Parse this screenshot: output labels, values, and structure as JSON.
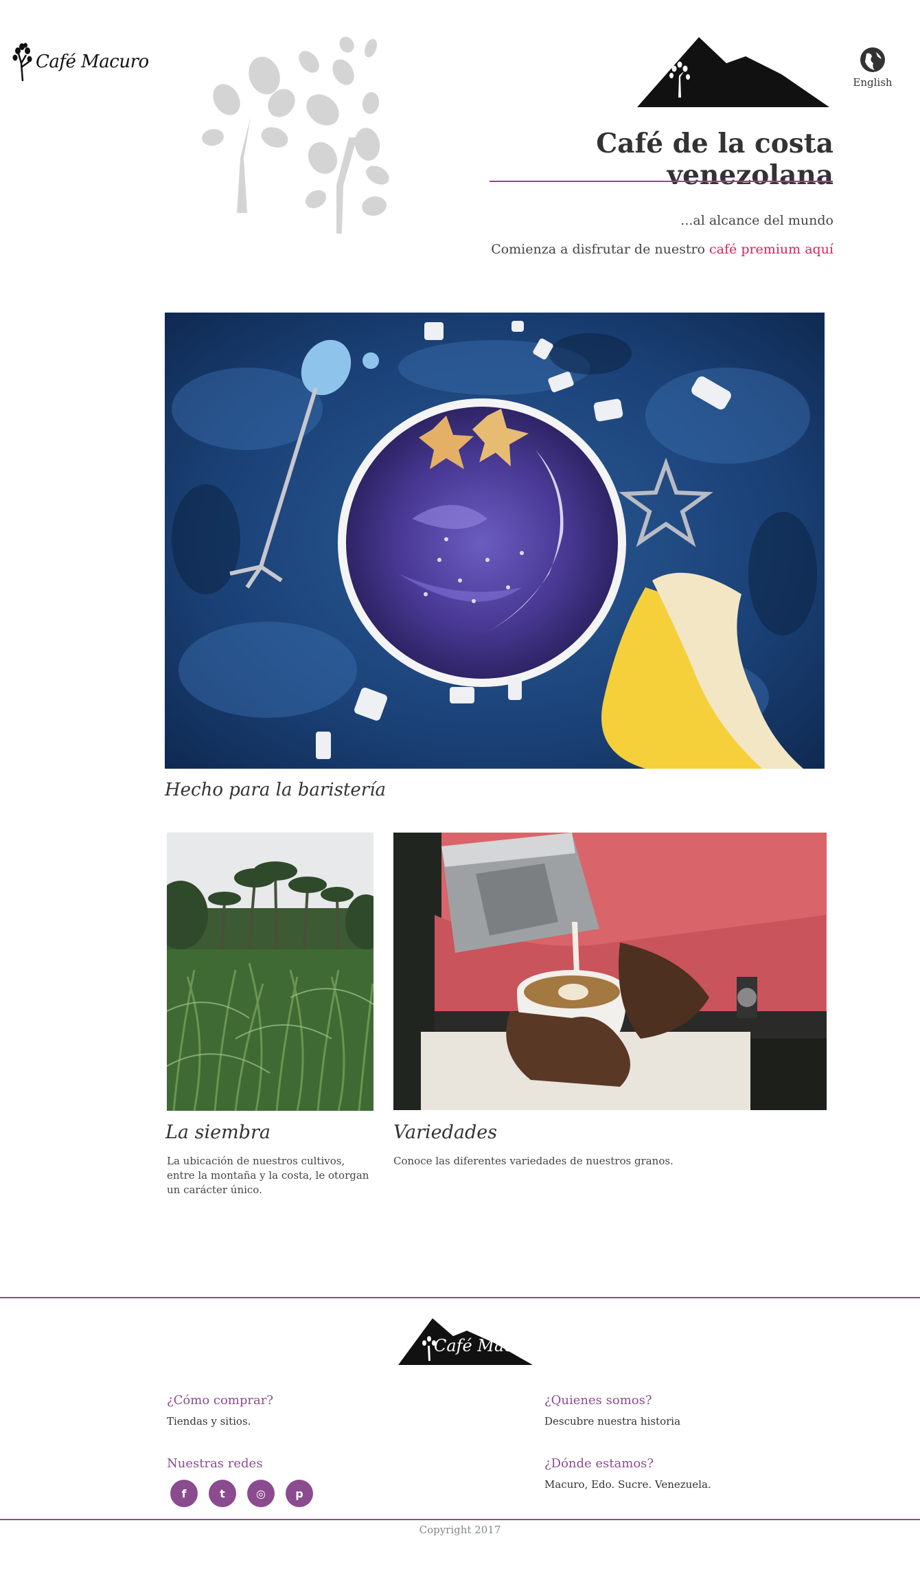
{
  "header": {
    "brand_name": "Café Macuro",
    "language_label": "English",
    "title": "Café de la costa venezolana",
    "tagline": "...al alcance del mundo",
    "cta_prefix": "Comienza a disfrutar de nuestro",
    "cta_link": "café premium aquí"
  },
  "hero": {
    "caption": "Hecho para la baristería"
  },
  "cards": [
    {
      "title": "La siembra",
      "description": "La ubicación de nuestros cultivos, entre la montaña y la costa, le otorgan un carácter único."
    },
    {
      "title": "Variedades",
      "description": "Conoce las diferentes variedades de nuestros granos."
    }
  ],
  "footer": {
    "brand_name": "Café Macuro",
    "how_to_buy": {
      "heading": "¿Cómo comprar?",
      "text": "Tiendas y sitios."
    },
    "about": {
      "heading": "¿Quienes somos?",
      "text": "Descubre nuestra historia"
    },
    "networks": {
      "heading": "Nuestras redes"
    },
    "location": {
      "heading": "¿Dónde estamos?",
      "text": "Macuro, Edo. Sucre. Venezuela."
    },
    "socials": [
      {
        "icon": "facebook-icon",
        "glyph": "f"
      },
      {
        "icon": "twitter-icon",
        "glyph": "t"
      },
      {
        "icon": "instagram-icon",
        "glyph": "◎"
      },
      {
        "icon": "pinterest-icon",
        "glyph": "p"
      }
    ],
    "copyright": "Copyright 2017"
  },
  "colors": {
    "accent": "#8b4b8f",
    "link": "#d9225c",
    "text": "#333333"
  }
}
